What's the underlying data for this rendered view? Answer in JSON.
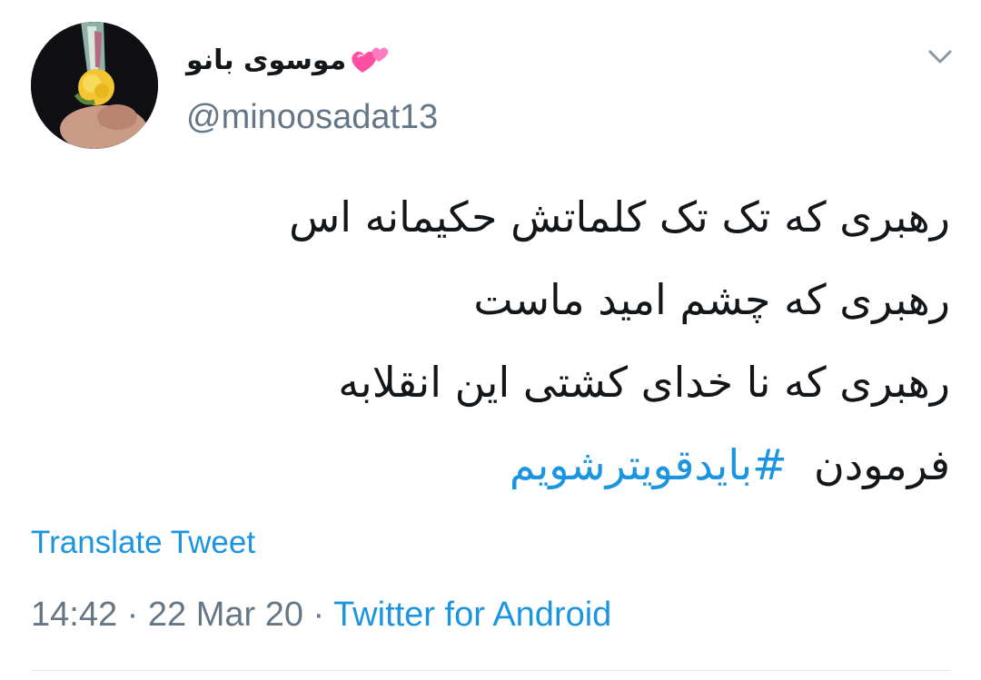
{
  "tweet": {
    "author": {
      "display_name": "موسوی بانو",
      "emoji_icon": "two-hearts-icon",
      "handle": "@minoosadat13"
    },
    "menu_icon": "chevron-down-icon",
    "text_lines": [
      "رهبری که تک تک کلماتش حکیمانه اس",
      "رهبری که چشم امید ماست",
      "رهبری که نا خدای کشتی این انقلابه",
      "فرمودن"
    ],
    "hashtag": "#بایدقویترشویم",
    "translate_label": "Translate Tweet",
    "time": "14:42",
    "date": "22 Mar 20",
    "separator": "·",
    "source": "Twitter for Android"
  },
  "colors": {
    "link": "#1b95e0",
    "muted": "#657786",
    "text": "#14171a",
    "divider": "#e1e8ed"
  }
}
